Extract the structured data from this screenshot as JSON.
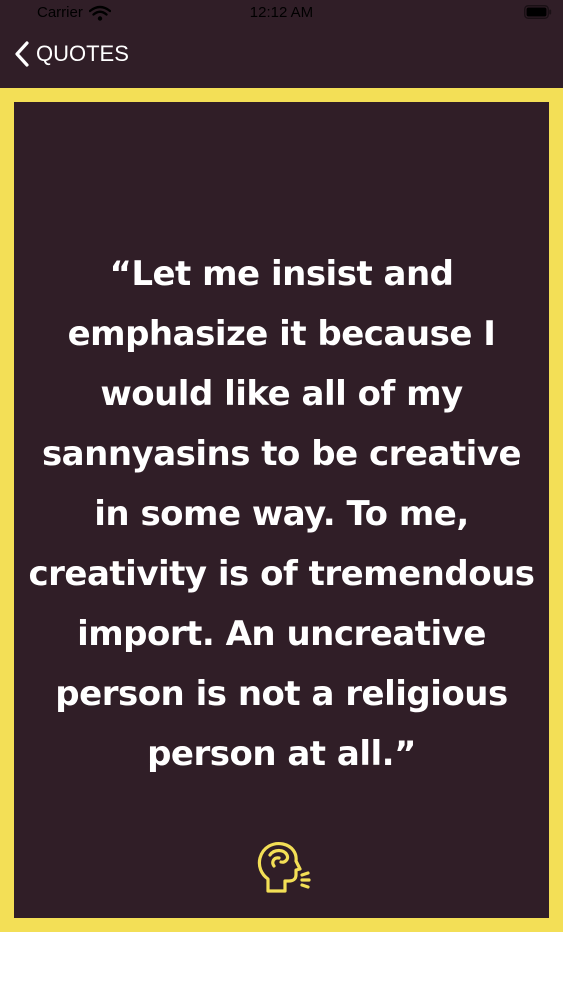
{
  "status_bar": {
    "carrier": "Carrier",
    "time": "12:12 AM",
    "wifi_icon": "wifi-icon",
    "battery_icon": "battery-icon"
  },
  "nav": {
    "back_label": "QUOTES",
    "back_icon": "chevron-left-icon"
  },
  "quote": {
    "text": "“Let me insist and emphasize it because I would like all of my sannyasins to be creative in some way. To me, creativity is of tremendous import. An uncreative person is not a religious person at all.”",
    "speak_icon": "speaking-head-icon"
  },
  "colors": {
    "background": "#301e27",
    "border": "#f3df56",
    "text": "#ffffff",
    "icon": "#f3df56"
  }
}
